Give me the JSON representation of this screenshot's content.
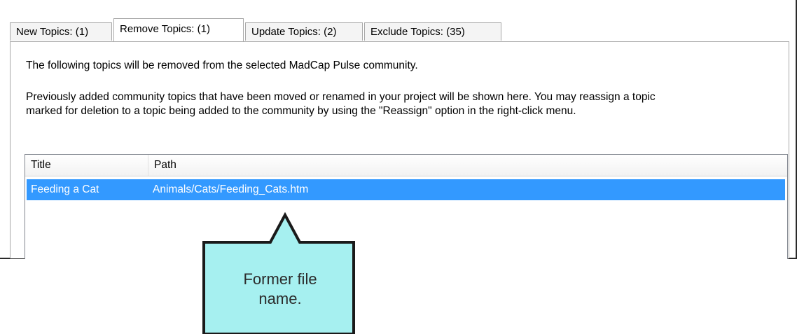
{
  "tabs": [
    {
      "label": "New Topics: (1)"
    },
    {
      "label": "Remove Topics: (1)"
    },
    {
      "label": "Update Topics: (2)"
    },
    {
      "label": "Exclude Topics: (35)"
    }
  ],
  "panel": {
    "line1": "The following topics will be removed from the selected MadCap Pulse community.",
    "line2": "Previously added community topics that have been moved or renamed in your project will be shown here. You may reassign a topic",
    "line3": "marked for deletion to a topic being added to the community by using the \"Reassign\" option in the right-click menu."
  },
  "list": {
    "columns": [
      "Title",
      "Path"
    ],
    "rows": [
      {
        "title": "Feeding a Cat",
        "path": "Animals/Cats/Feeding_Cats.htm",
        "selected": true
      }
    ]
  },
  "callout": {
    "line1": "Former file",
    "line2": "name.",
    "fill": "#a6f0f0",
    "stroke": "#1a1a1a"
  },
  "colors": {
    "selection": "#3399ff"
  }
}
